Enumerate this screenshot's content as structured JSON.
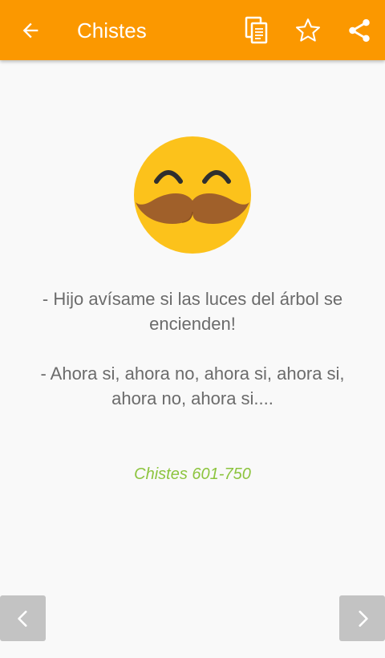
{
  "app_bar": {
    "title": "Chistes",
    "icons": {
      "back": "arrow-back-icon",
      "copy": "copy-icon",
      "favorite": "star-outline-icon",
      "share": "share-icon"
    }
  },
  "joke": {
    "line1": "- Hijo avísame si las luces del árbol se encienden!",
    "line2": "- Ahora si, ahora no, ahora si, ahora si, ahora no, ahora si...."
  },
  "category_label": "Chistes 601-750",
  "emoji_icon": "mustache-smile-emoji",
  "navigation": {
    "prev_icon": "chevron-left-icon",
    "next_icon": "chevron-right-icon"
  },
  "colors": {
    "app_bar": "#fb9800",
    "category_text": "#8cc43e",
    "body_text": "#6b6b6b",
    "nav_button": "#c3c3c3"
  }
}
